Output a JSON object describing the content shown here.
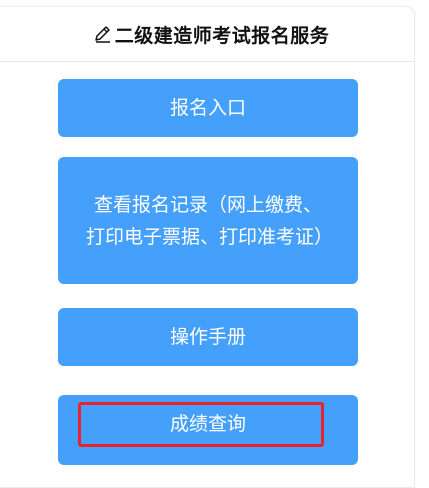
{
  "header": {
    "title": "二级建造师考试报名服务",
    "icon": "pen-icon"
  },
  "buttons": {
    "register_entry": "报名入口",
    "view_records": "查看报名记录（网上缴费、打印电子票据、打印准考证）",
    "manual": "操作手册",
    "score_query": "成绩查询"
  },
  "colors": {
    "button_bg": "#45a0fb",
    "highlight_border": "#e8232a"
  }
}
